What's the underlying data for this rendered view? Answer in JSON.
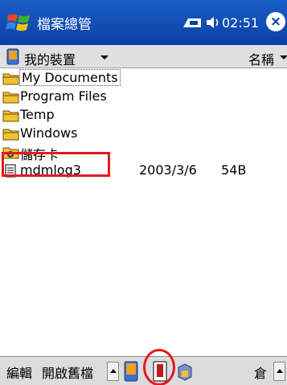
{
  "titlebar": {
    "title": "檔案總管",
    "clock": "02:51",
    "close": "×"
  },
  "locbar": {
    "location": "我的裝置",
    "sort": "名稱"
  },
  "files": [
    {
      "name": "My Documents",
      "type": "folder",
      "date": "",
      "size": ""
    },
    {
      "name": "Program Files",
      "type": "folder",
      "date": "",
      "size": ""
    },
    {
      "name": "Temp",
      "type": "folder",
      "date": "",
      "size": ""
    },
    {
      "name": "Windows",
      "type": "folder",
      "date": "",
      "size": ""
    },
    {
      "name": "儲存卡",
      "type": "storage-card",
      "date": "",
      "size": ""
    },
    {
      "name": "mdmlog3",
      "type": "file",
      "date": "2003/3/6",
      "size": "54B"
    }
  ],
  "cmdbar": {
    "edit": "編輯",
    "open": "開啟舊檔",
    "right": "倉"
  },
  "colors": {
    "title_bg": "#0b3fa3",
    "folder": "#f2c230",
    "highlight": "#e11a22"
  }
}
